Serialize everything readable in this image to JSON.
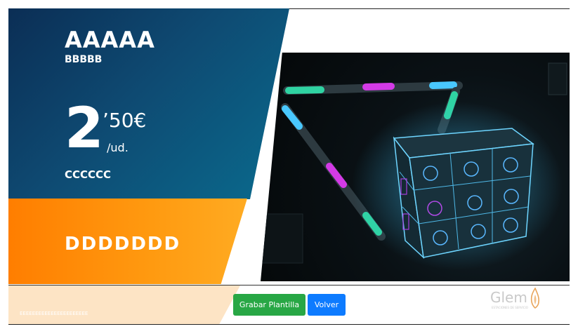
{
  "product": {
    "title": "AAAAA",
    "subtitle": "BBBBB",
    "price_integer": "2",
    "price_decimal": "’50€",
    "price_unit": "/ud.",
    "line_c": "CCCCCC",
    "line_d": "DDDDDDD"
  },
  "footer": {
    "small_text": "EEEEEEEEEEEEEEEEEEEEEE",
    "buttons": {
      "save": "Grabar Plantilla",
      "back": "Volver"
    },
    "logo": {
      "name": "Glem",
      "tagline": "ESTACIONES DE SERVICIO"
    }
  },
  "colors": {
    "blue_panel": "#0e4a72",
    "orange_panel": "#ff8c0a",
    "save_button": "#28a745",
    "back_button": "#0d7bff"
  }
}
